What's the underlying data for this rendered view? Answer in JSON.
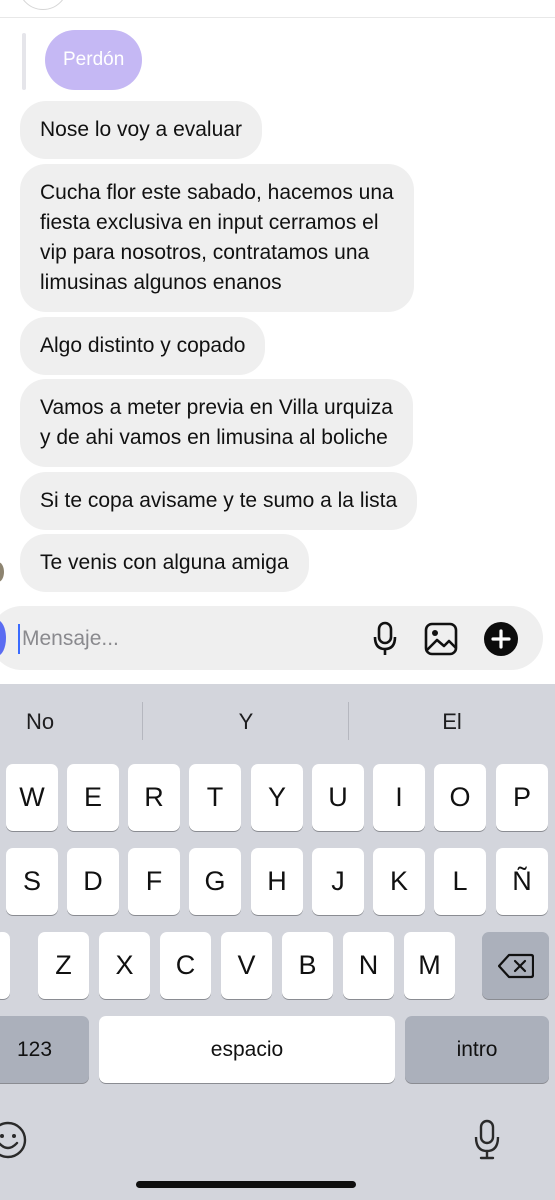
{
  "reply": {
    "text": "Perdón"
  },
  "messages": [
    {
      "text": "Nose lo voy a evaluar"
    },
    {
      "text": "Cucha flor este sabado, hacemos una\nfiesta exclusiva en input cerramos el\nvip para nosotros, contratamos una\nlimusinas algunos enanos"
    },
    {
      "text": "Algo distinto y copado"
    },
    {
      "text": "Vamos a meter previa en Villa urquiza\ny de ahi vamos en limusina al boliche"
    },
    {
      "text": "Si te copa avisame y te sumo a la lista"
    },
    {
      "text": "Te venis con alguna amiga"
    }
  ],
  "composer": {
    "placeholder": "Mensaje...",
    "icons": [
      "microphone-icon",
      "image-icon",
      "plus-icon"
    ]
  },
  "keyboard": {
    "suggestions": [
      "No",
      "Y",
      "El"
    ],
    "row1": [
      "W",
      "E",
      "R",
      "T",
      "Y",
      "U",
      "I",
      "O",
      "P"
    ],
    "row2": [
      "S",
      "D",
      "F",
      "G",
      "H",
      "J",
      "K",
      "L",
      "Ñ"
    ],
    "row3": [
      "Z",
      "X",
      "C",
      "V",
      "B",
      "N",
      "M"
    ],
    "numbers_label": "123",
    "space_label": "espacio",
    "return_label": "intro",
    "icons": [
      "backspace-icon",
      "emoji-icon",
      "dictation-icon"
    ]
  },
  "colors": {
    "reply_bubble": "#c5b8f4",
    "message_bubble": "#efefef",
    "keyboard_bg": "#d3d5dc",
    "dark_key": "#abb0bb",
    "cursor": "#3a6bff"
  }
}
